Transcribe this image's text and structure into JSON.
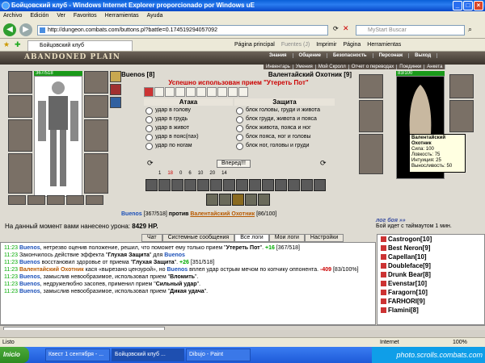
{
  "window": {
    "title": "Бойцовский клуб - Windows Internet Explorer proporcionado por Windows uE"
  },
  "menu": [
    "Archivo",
    "Edición",
    "Ver",
    "Favoritos",
    "Herramientas",
    "Ayuda"
  ],
  "address": {
    "url": "http://dungeon.combats.com/buttons.pl?battle=0.174519294057092",
    "search_placeholder": "MyStart Buscar"
  },
  "tab": {
    "label": "Бойцовский клуб"
  },
  "ie_tools": [
    "Página principal",
    "Fuentes (J)",
    "Imprimir",
    "Página",
    "Herramientas"
  ],
  "game": {
    "logo": "ABANDONED PLAIN",
    "topnav": [
      "Знания",
      "Общение",
      "Безопасность",
      "Персонаж",
      "Выход"
    ],
    "topnav2": [
      "Инвентарь",
      "Умения",
      "Мой Скролл",
      "Отчет о переводах",
      "Поединки",
      "Анкета"
    ],
    "player": {
      "name": "Buenos [8]",
      "hp": "367/518"
    },
    "opponent": {
      "name": "Валентайский Охотник [9]",
      "hp": "83/100"
    },
    "success": "Успешно использован прием \"Утереть Пот\"",
    "attack": {
      "title": "Атака",
      "options": [
        "удар в голову",
        "удар в грудь",
        "удар в живот",
        "удар в пояс(пах)",
        "удар по ногам"
      ]
    },
    "defense": {
      "title": "Защита",
      "options": [
        "блок головы, груди и живота",
        "блок груди, живота и пояса",
        "блок живота, пояса и ног",
        "блок пояса, ног и головы",
        "блок ног, головы и груди"
      ]
    },
    "forward": "Вперед!!!",
    "counters": [
      "1",
      "18",
      "0",
      "6",
      "10",
      "20",
      "14"
    ],
    "vs": {
      "left": "Buenos",
      "left_hp": "[367/518]",
      "mid": "против",
      "right": "Валентайский Охотник",
      "right_hp": "[86/100]"
    },
    "damage": {
      "text": "На данный момент вами нанесено урона:",
      "value": "8429 HP."
    },
    "tooltip": {
      "name": "Валентайский Охотник",
      "lines": [
        "Сила: 100",
        "Ловкость: 75",
        "Интуиция: 25",
        "Выносливость: 50"
      ]
    },
    "log_right": {
      "title": "лог боя »»",
      "sub": "Бой идет с таймаутом 1 мин."
    },
    "chat_tabs": [
      "Чат",
      "Системные сообщения",
      "Все логи",
      "Мои логи",
      "Настройки"
    ],
    "chat": [
      {
        "t": "11:23",
        "html": "<span class='n'>Buenos</span>, нетрезво оценив положение, решил, что поможет ему только прием \"<b>Утереть Пот</b>\". <span style='color:#0a0;font-weight:bold'>+16</span> [367/518]"
      },
      {
        "t": "11:23",
        "html": "Закончилось действие эффекта \"<b>Глухая Защита</b>\" для <span class='n'>Buenos</span>"
      },
      {
        "t": "11:23",
        "html": "<span class='n'>Buenos</span> восстановил здоровье от приема \"<b>Глухая Защита</b>\". <span style='color:#0a0;font-weight:bold'>+26</span> [351/518]"
      },
      {
        "t": "11:23",
        "html": "<span class='o'>Валентайский Охотник</span> кася «вырезано цензурой», но <span class='n'>Buenos</span> вплел удар острым мечом по копчику оппонента. <span class='r'>-409</span> [83/100%]"
      },
      {
        "t": "11:23",
        "html": "<span class='n'>Buenos</span>, замыслив невообразимое, использовал прием \"<b>Вломить</b>\"."
      },
      {
        "t": "11:23",
        "html": "<span class='n'>Buenos</span>, недружелюбно засопев, применил прием \"<b>Сильный удар</b>\"."
      },
      {
        "t": "11:23",
        "html": "<span class='n'>Buenos</span>, замыслив невообразимое, использовал прием \"<b>Дикая удача</b>\"."
      }
    ],
    "users": [
      "Castrogon[10]",
      "Best Neron[9]",
      "Capellan[10]",
      "Doubleface[9]",
      "Drunk Bear[8]",
      "Evenstar[10]",
      "Faragorn[10]",
      "FARHORI[9]",
      "Flamini[8]"
    ]
  },
  "status": {
    "left": "Listo",
    "zone": "Internet",
    "zoom": "100%"
  },
  "taskbar": {
    "start": "Inicio",
    "buttons": [
      "Квест 1 сентября - ...",
      "Бойцовский клуб ...",
      "Dibujo - Paint"
    ],
    "tray": "photo.scrolls.combats.com"
  }
}
